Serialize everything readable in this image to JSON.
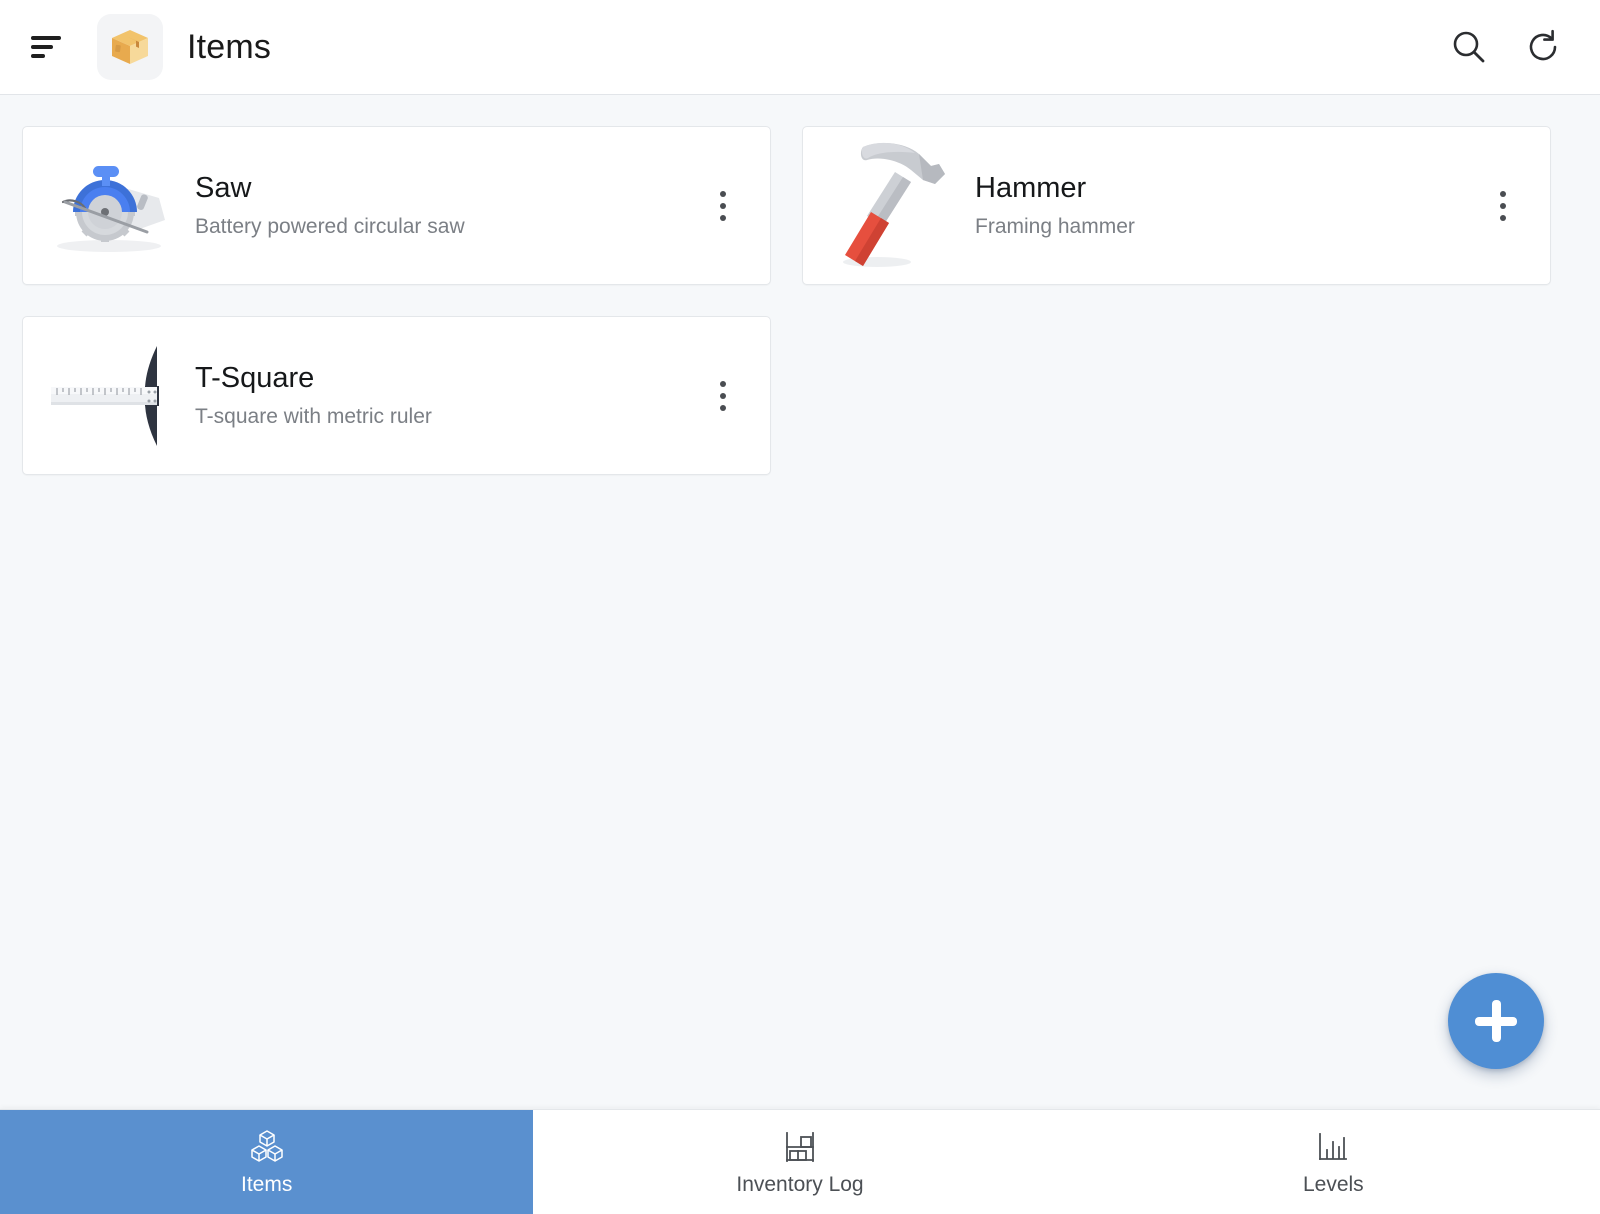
{
  "header": {
    "menu_icon": "sort-lines-icon",
    "logo_icon": "package-box-icon",
    "title": "Items",
    "actions": [
      {
        "name": "search",
        "icon": "search-icon"
      },
      {
        "name": "refresh",
        "icon": "refresh-icon"
      }
    ]
  },
  "items": [
    {
      "title": "Saw",
      "subtitle": "Battery powered circular saw",
      "thumb_icon": "circular-saw-icon",
      "menu_icon": "kebab-menu-icon"
    },
    {
      "title": "Hammer",
      "subtitle": "Framing hammer",
      "thumb_icon": "hammer-icon",
      "menu_icon": "kebab-menu-icon"
    },
    {
      "title": "T-Square",
      "subtitle": "T-square with metric ruler",
      "thumb_icon": "t-square-icon",
      "menu_icon": "kebab-menu-icon"
    }
  ],
  "fab": {
    "icon": "plus-icon",
    "label": "",
    "color": "#4f8ed4"
  },
  "bottom_nav": {
    "active_index": 0,
    "active_color": "#5a90cf",
    "tabs": [
      {
        "label": "Items",
        "icon": "boxes-icon"
      },
      {
        "label": "Inventory Log",
        "icon": "shelf-rack-icon"
      },
      {
        "label": "Levels",
        "icon": "bar-chart-icon"
      }
    ]
  },
  "colors": {
    "background": "#f6f8fa",
    "card": "#ffffff",
    "accent": "#4f8ed4",
    "title_text": "#16181a",
    "subtitle_text": "#7b7f85"
  }
}
